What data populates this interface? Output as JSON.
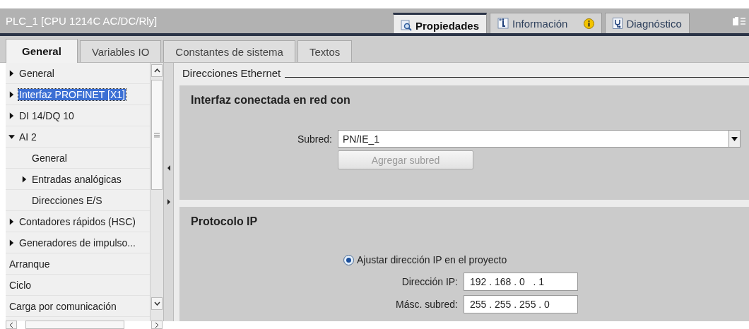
{
  "window": {
    "title": "PLC_1 [CPU 1214C AC/DC/Rly]"
  },
  "panel_tabs": [
    {
      "label": "Propiedades",
      "selected": true,
      "kind": "properties"
    },
    {
      "label": "Información",
      "selected": false,
      "kind": "info"
    },
    {
      "label": "Diagnóstico",
      "selected": false,
      "kind": "diagnostics"
    }
  ],
  "tabs": [
    {
      "label": "General",
      "selected": true
    },
    {
      "label": "Variables IO",
      "selected": false
    },
    {
      "label": "Constantes de sistema",
      "selected": false
    },
    {
      "label": "Textos",
      "selected": false
    }
  ],
  "tree": [
    {
      "label": "General",
      "kind": "branch",
      "expanded": false,
      "selected": false
    },
    {
      "label": "Interfaz PROFINET [X1]",
      "kind": "branch",
      "expanded": false,
      "selected": true
    },
    {
      "label": "DI 14/DQ 10",
      "kind": "branch",
      "expanded": false,
      "selected": false
    },
    {
      "label": "AI 2",
      "kind": "branch",
      "expanded": true,
      "selected": false,
      "children": [
        {
          "label": "General",
          "kind": "leaf",
          "selected": false
        },
        {
          "label": "Entradas analógicas",
          "kind": "branch",
          "expanded": false,
          "selected": false
        },
        {
          "label": "Direcciones E/S",
          "kind": "leaf",
          "selected": false
        }
      ]
    },
    {
      "label": "Contadores rápidos (HSC)",
      "kind": "branch",
      "expanded": false,
      "selected": false
    },
    {
      "label": "Generadores de impulso...",
      "kind": "branch",
      "expanded": false,
      "selected": false
    },
    {
      "label": "Arranque",
      "kind": "leaf",
      "selected": false
    },
    {
      "label": "Ciclo",
      "kind": "leaf",
      "selected": false
    },
    {
      "label": "Carga por comunicación",
      "kind": "leaf",
      "selected": false
    }
  ],
  "section_title": "Direcciones Ethernet",
  "network_group": {
    "title": "Interfaz conectada en red con",
    "subnet_label": "Subred:",
    "subnet_value": "PN/IE_1",
    "add_button": {
      "label": "Agregar subred",
      "disabled": true
    }
  },
  "ip_group": {
    "title": "Protocolo IP",
    "radio": {
      "label": "Ajustar dirección IP en el proyecto",
      "selected": true
    },
    "fields": [
      {
        "label": "Dirección IP:",
        "value": "192 . 168 . 0   . 1"
      },
      {
        "label": "Másc. subred:",
        "value": "255 . 255 . 255 . 0"
      }
    ]
  }
}
